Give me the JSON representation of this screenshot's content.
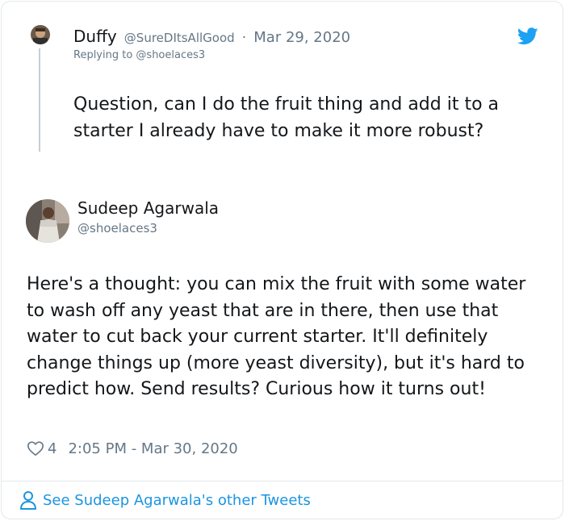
{
  "reply": {
    "name": "Duffy",
    "handle": "@SureDItsAllGood",
    "separator": "·",
    "date": "Mar 29, 2020",
    "replying_to": "Replying to @shoelaces3",
    "text": "Question, can I do the fruit thing and add it to a starter I already have to make it more robust?"
  },
  "tweet": {
    "author_name": "Sudeep Agarwala",
    "author_handle": "@shoelaces3",
    "text": "Here's a thought: you can mix the fruit with some water to wash off any yeast that are in there, then use that water to cut back your current starter. It'll definitely change things up (more yeast diversity), but it's hard to predict how. Send results? Curious how it turns out!",
    "like_count": "4",
    "timestamp": "2:05 PM - Mar 30, 2020"
  },
  "footer": {
    "link_text": "See Sudeep Agarwala's other Tweets"
  },
  "icons": {
    "brand": "twitter-bird-icon",
    "like": "heart-icon",
    "footer": "person-icon"
  },
  "colors": {
    "accent": "#1b95e0",
    "text": "#14171a",
    "muted": "#657786",
    "border": "#e1e8ed"
  }
}
